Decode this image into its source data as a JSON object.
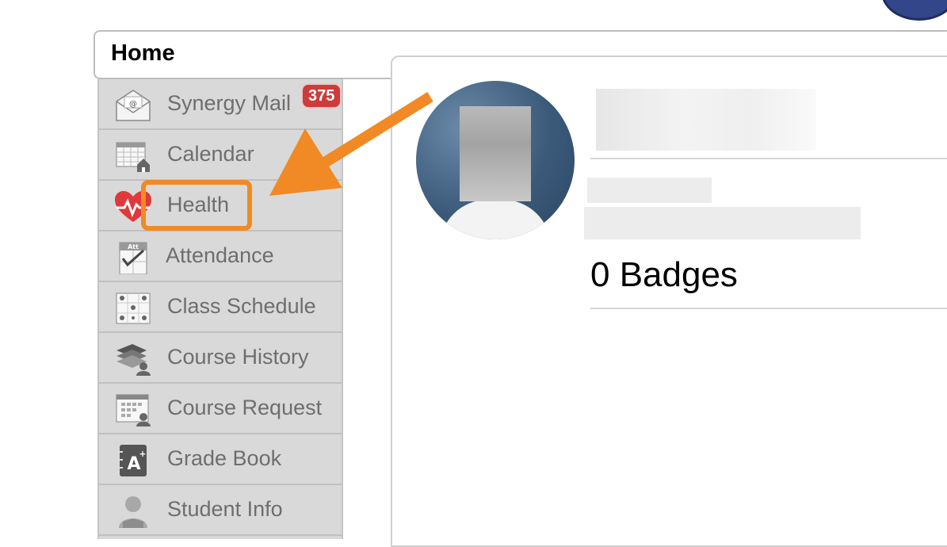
{
  "header": {
    "home_tab_label": "Home"
  },
  "sidebar": {
    "items": [
      {
        "label": "Synergy Mail",
        "icon": "mail-icon"
      },
      {
        "label": "Calendar",
        "icon": "calendar-icon"
      },
      {
        "label": "Health",
        "icon": "heart-pulse-icon"
      },
      {
        "label": "Attendance",
        "icon": "attendance-icon"
      },
      {
        "label": "Class Schedule",
        "icon": "class-schedule-icon"
      },
      {
        "label": "Course History",
        "icon": "course-history-icon"
      },
      {
        "label": "Course Request",
        "icon": "course-request-icon"
      },
      {
        "label": "Grade Book",
        "icon": "grade-book-icon"
      },
      {
        "label": "Student Info",
        "icon": "student-info-icon"
      }
    ],
    "mail_unread_count": "375"
  },
  "profile": {
    "badges_text": "0 Badges"
  },
  "annotation": {
    "arrow_color": "#f18a24",
    "highlight_target": "Health"
  }
}
